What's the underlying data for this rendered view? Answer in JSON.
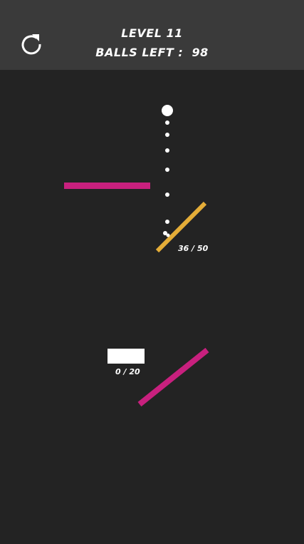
{
  "app": {
    "level_label": "LEVEL 11",
    "balls_left_label": "BALLS LEFT :",
    "balls_left_value": "98"
  },
  "icons": {
    "restart": "restart-icon"
  },
  "colors": {
    "background": "#232323",
    "header_bar": "#3a3a3a",
    "pink_bar": "#c8207e",
    "yellow_bar": "#e4ad38",
    "ball": "#ffffff",
    "text": "#ffffff"
  },
  "game": {
    "bucket_a": {
      "filled": 36,
      "capacity": 50,
      "counter_text": "36 / 50"
    },
    "bucket_b": {
      "filled": 0,
      "capacity": 20,
      "counter_text": "0 / 20"
    }
  }
}
